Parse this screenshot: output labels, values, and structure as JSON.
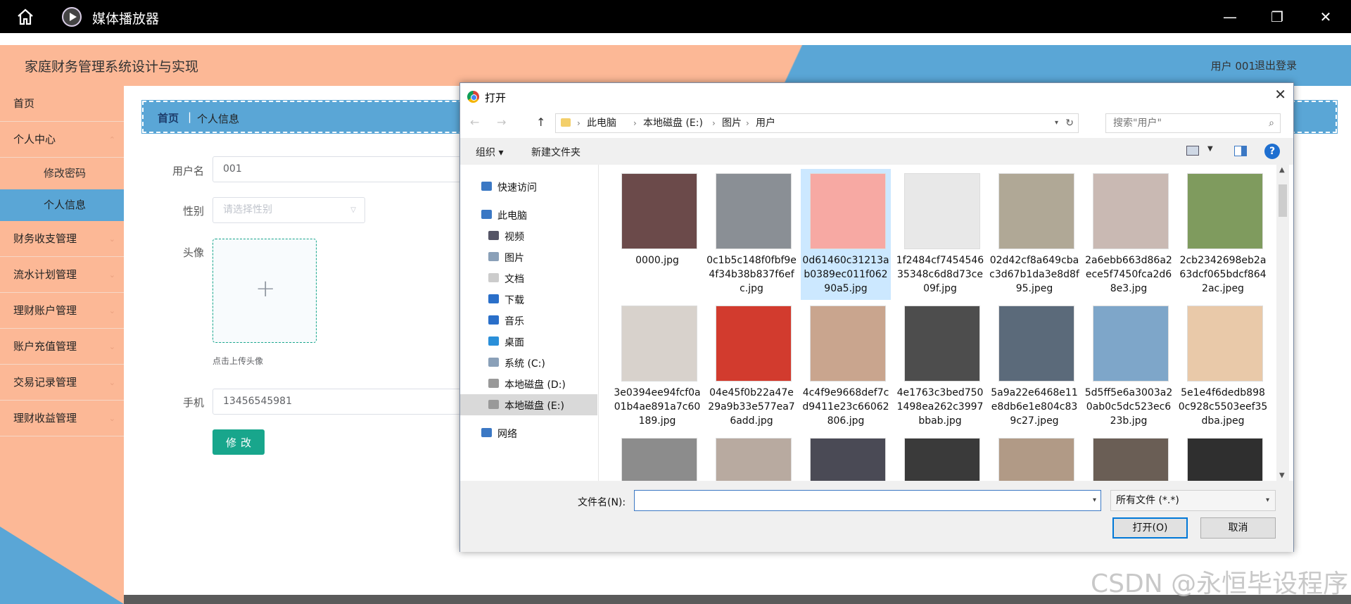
{
  "player": {
    "title": "媒体播放器",
    "minimize": "—",
    "restore": "❐",
    "close": "✕"
  },
  "app": {
    "title": "家庭财务管理系统设计与实现",
    "user": "用户 001",
    "logout": "退出登录"
  },
  "sidebar": {
    "items": [
      {
        "label": "首页"
      },
      {
        "label": "个人中心",
        "chev": "⌃"
      },
      {
        "label": "财务收支管理",
        "chev": "⌄"
      },
      {
        "label": "流水计划管理",
        "chev": "⌄"
      },
      {
        "label": "理财账户管理",
        "chev": "⌄"
      },
      {
        "label": "账户充值管理",
        "chev": "⌄"
      },
      {
        "label": "交易记录管理",
        "chev": "⌄"
      },
      {
        "label": "理财收益管理",
        "chev": "⌄"
      }
    ],
    "sub": [
      {
        "label": "修改密码"
      },
      {
        "label": "个人信息"
      }
    ]
  },
  "breadcrumb": {
    "home": "首页",
    "sep": "|",
    "current": "个人信息"
  },
  "form": {
    "username_label": "用户名",
    "username_value": "001",
    "gender_label": "性别",
    "gender_placeholder": "请选择性别",
    "avatar_label": "头像",
    "avatar_tip": "点击上传头像",
    "phone_label": "手机",
    "phone_value": "13456545981",
    "save": "修改"
  },
  "dialog": {
    "title": "打开",
    "path": [
      "此电脑",
      "本地磁盘 (E:)",
      "图片",
      "用户"
    ],
    "search_placeholder": "搜索\"用户\"",
    "organize": "组织 ▾",
    "new_folder": "新建文件夹",
    "tree": [
      {
        "label": "快速访问",
        "icon_color": "#3b78c4",
        "icon": "star-icon"
      },
      {
        "label": "此电脑",
        "icon_color": "#3b78c4",
        "icon": "computer-icon"
      },
      {
        "label": "视频",
        "icon_color": "#556",
        "icon": "video-icon"
      },
      {
        "label": "图片",
        "icon_color": "#8aa0b8",
        "icon": "picture-icon"
      },
      {
        "label": "文档",
        "icon_color": "#bbb",
        "icon": "document-icon"
      },
      {
        "label": "下载",
        "icon_color": "#2a6fc9",
        "icon": "download-icon"
      },
      {
        "label": "音乐",
        "icon_color": "#2a6fc9",
        "icon": "music-icon"
      },
      {
        "label": "桌面",
        "icon_color": "#2a8fd9",
        "icon": "desktop-icon"
      },
      {
        "label": "系统 (C:)",
        "icon_color": "#8aa0b8",
        "icon": "drive-icon"
      },
      {
        "label": "本地磁盘 (D:)",
        "icon_color": "#999",
        "icon": "drive-icon"
      },
      {
        "label": "本地磁盘 (E:)",
        "icon_color": "#999",
        "icon": "drive-icon"
      },
      {
        "label": "网络",
        "icon_color": "#3b78c4",
        "icon": "network-icon"
      }
    ],
    "files": [
      {
        "name": "0000.jpg",
        "color": "#6b4a4a"
      },
      {
        "name": "0c1b5c148f0fbf9e4f34b38b837f6efc.jpg",
        "color": "#8a8f95"
      },
      {
        "name": "0d61460c31213ab0389ec011f06290a5.jpg",
        "color": "#f7a9a3"
      },
      {
        "name": "1f2484cf745454635348c6d8d73ce09f.jpg",
        "color": "#e8e8e8"
      },
      {
        "name": "02d42cf8a649cbac3d67b1da3e8d8f95.jpeg",
        "color": "#b0a896"
      },
      {
        "name": "2a6ebb663d86a2ece5f7450fca2d68e3.jpg",
        "color": "#c9b9b3"
      },
      {
        "name": "2cb2342698eb2a63dcf065bdcf8642ac.jpeg",
        "color": "#7f9b5e"
      },
      {
        "name": "3e0394ee94fcf0a01b4ae891a7c60189.jpg",
        "color": "#d8d2cc"
      },
      {
        "name": "04e45f0b22a47e29a9b33e577ea76add.jpg",
        "color": "#d23b2e"
      },
      {
        "name": "4c4f9e9668def7cd9411e23c66062806.jpg",
        "color": "#c9a58e"
      },
      {
        "name": "4e1763c3bed7501498ea262c3997bbab.jpg",
        "color": "#4d4d4d"
      },
      {
        "name": "5a9a22e6468e11e8db6e1e804c839c27.jpeg",
        "color": "#5b6a7a"
      },
      {
        "name": "5d5ff5e6a3003a20ab0c5dc523ec623b.jpg",
        "color": "#7ea6c9"
      },
      {
        "name": "5e1e4f6dedb8980c928c5503eef35dba.jpeg",
        "color": "#e9c9a9"
      },
      {
        "name": "",
        "color": "#8c8c8c"
      },
      {
        "name": "",
        "color": "#b8aaa0"
      },
      {
        "name": "",
        "color": "#4a4a55"
      },
      {
        "name": "",
        "color": "#3a3a3a"
      },
      {
        "name": "",
        "color": "#b19a86"
      },
      {
        "name": "",
        "color": "#6a5e55"
      },
      {
        "name": "",
        "color": "#2f2f2f"
      }
    ],
    "filename_label": "文件名(N):",
    "filename_value": "",
    "filetype": "所有文件 (*.*)",
    "open": "打开(O)",
    "cancel": "取消"
  },
  "watermark": "CSDN @永恒毕设程序",
  "colors": {
    "salmon": "#fcb896",
    "blue": "#5aa6d6",
    "teal": "#18a68c"
  }
}
